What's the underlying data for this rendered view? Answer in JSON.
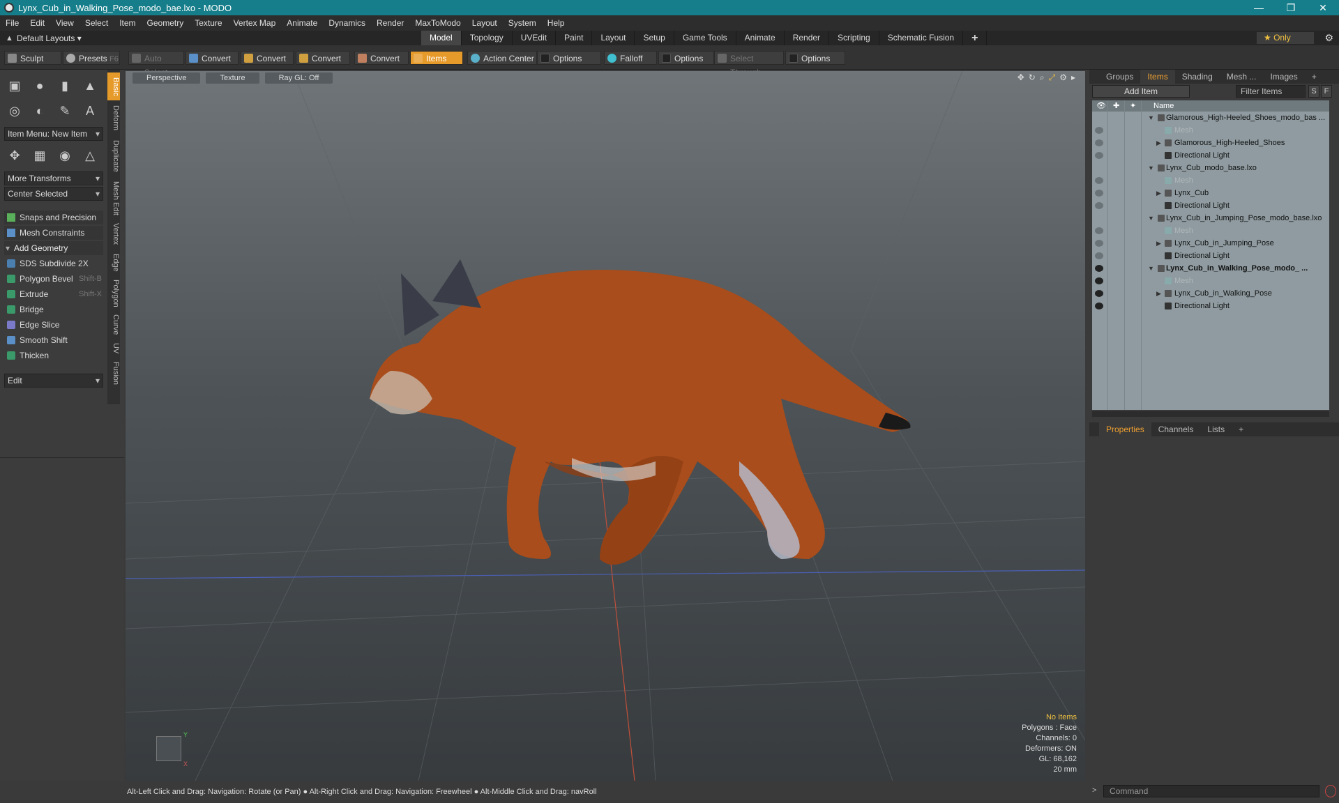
{
  "window": {
    "title": "Lynx_Cub_in_Walking_Pose_modo_bae.lxo - MODO",
    "minimize": "—",
    "maximize": "❐",
    "close": "✕"
  },
  "menu": [
    "File",
    "Edit",
    "View",
    "Select",
    "Item",
    "Geometry",
    "Texture",
    "Vertex Map",
    "Animate",
    "Dynamics",
    "Render",
    "MaxToModo",
    "Layout",
    "System",
    "Help"
  ],
  "layout_bar": {
    "layouts_dropdown": "Default Layouts",
    "tabs": [
      "Model",
      "Topology",
      "UVEdit",
      "Paint",
      "Layout",
      "Setup",
      "Game Tools",
      "Animate",
      "Render",
      "Scripting",
      "Schematic Fusion",
      "+"
    ],
    "active_tab": "Model",
    "only_label": "★  Only"
  },
  "toolbar": {
    "sculpt": "Sculpt",
    "presets": "Presets",
    "presets_key": "F6",
    "auto_select": "Auto Select",
    "convert": "Convert",
    "items": "Items",
    "action_center": "Action Center",
    "options": "Options",
    "falloff": "Falloff",
    "select_through": "Select Through"
  },
  "left_panel": {
    "item_menu": "Item Menu: New Item",
    "more_transforms": "More Transforms",
    "center_selected": "Center Selected",
    "snaps": "Snaps and Precision",
    "mesh_constraints": "Mesh Constraints",
    "add_geometry": "Add Geometry",
    "tools": [
      {
        "label": "SDS Subdivide 2X",
        "shortcut": ""
      },
      {
        "label": "Polygon Bevel",
        "shortcut": "Shift-B"
      },
      {
        "label": "Extrude",
        "shortcut": "Shift-X"
      },
      {
        "label": "Bridge",
        "shortcut": ""
      },
      {
        "label": "Edge Slice",
        "shortcut": ""
      },
      {
        "label": "Smooth Shift",
        "shortcut": ""
      },
      {
        "label": "Thicken",
        "shortcut": ""
      }
    ],
    "edit_dropdown": "Edit",
    "vertical_tabs": [
      "Basic",
      "Deform",
      "Duplicate",
      "Mesh Edit",
      "Vertex",
      "Edge",
      "Polygon",
      "Curve",
      "UV",
      "Fusion"
    ]
  },
  "viewport": {
    "tabs": [
      "Perspective",
      "Texture",
      "Ray GL: Off"
    ],
    "info": [
      "No Items",
      "Polygons : Face",
      "Channels: 0",
      "Deformers: ON",
      "GL: 68,162",
      "20 mm"
    ],
    "axis_y": "Y",
    "axis_x": "X"
  },
  "status_bar": "Alt-Left Click and Drag: Navigation: Rotate (or Pan) ● Alt-Right Click and Drag: Navigation: Freewheel ● Alt-Middle Click and Drag: navRoll",
  "right_panel": {
    "tabs": [
      "Groups",
      "Items",
      "Shading",
      "Mesh ...",
      "Images",
      "+"
    ],
    "active_tab": "Items",
    "add_item": "Add Item",
    "filter_items": "Filter Items",
    "s_btn": "S",
    "f_btn": "F",
    "name_col": "Name",
    "tree": [
      {
        "label": "Glamorous_High-Heeled_Shoes_modo_bas ...",
        "level": 0,
        "type": "scene",
        "bold": false
      },
      {
        "label": "Mesh",
        "level": 1,
        "type": "mesh",
        "bold": false
      },
      {
        "label": "Glamorous_High-Heeled_Shoes",
        "level": 1,
        "type": "group",
        "bold": false
      },
      {
        "label": "Directional Light",
        "level": 1,
        "type": "light",
        "bold": false
      },
      {
        "label": "Lynx_Cub_modo_base.lxo",
        "level": 0,
        "type": "scene",
        "bold": false
      },
      {
        "label": "Mesh",
        "level": 1,
        "type": "mesh",
        "bold": false
      },
      {
        "label": "Lynx_Cub",
        "level": 1,
        "type": "group",
        "bold": false
      },
      {
        "label": "Directional Light",
        "level": 1,
        "type": "light",
        "bold": false
      },
      {
        "label": "Lynx_Cub_in_Jumping_Pose_modo_base.lxo",
        "level": 0,
        "type": "scene",
        "bold": false
      },
      {
        "label": "Mesh",
        "level": 1,
        "type": "mesh",
        "bold": false
      },
      {
        "label": "Lynx_Cub_in_Jumping_Pose",
        "level": 1,
        "type": "group",
        "bold": false
      },
      {
        "label": "Directional Light",
        "level": 1,
        "type": "light",
        "bold": false
      },
      {
        "label": "Lynx_Cub_in_Walking_Pose_modo_ ...",
        "level": 0,
        "type": "scene",
        "bold": true
      },
      {
        "label": "Mesh",
        "level": 1,
        "type": "mesh",
        "bold": true
      },
      {
        "label": "Lynx_Cub_in_Walking_Pose",
        "level": 1,
        "type": "group",
        "bold": true
      },
      {
        "label": "Directional Light",
        "level": 1,
        "type": "light",
        "bold": true
      }
    ],
    "props_tabs": [
      "Properties",
      "Channels",
      "Lists",
      "+"
    ],
    "props_active": "Properties",
    "command_placeholder": "Command"
  },
  "colors": {
    "accent": "#e69a2a",
    "titlebar": "#167e8a",
    "tree_bg": "#8f9ba0"
  }
}
